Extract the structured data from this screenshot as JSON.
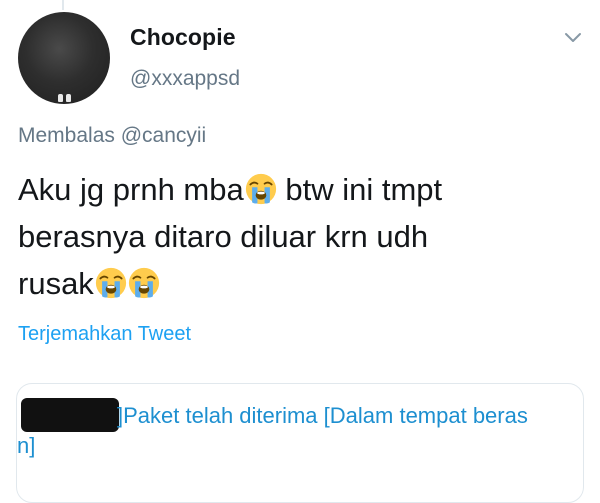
{
  "tweet": {
    "author": {
      "display_name": "Chocopie",
      "handle": "@xxxappsd"
    },
    "reply_prefix": "Membalas",
    "reply_to": "@cancyii",
    "text_lines": [
      "Aku jg prnh mba",
      " btw ini tmpt",
      "berasnya ditaro diluar krn udh",
      "rusak"
    ],
    "emoji": "loudly-crying-face",
    "translate_label": "Terjemahkan Tweet",
    "quote": {
      "line1": "]Paket telah diterima [Dalam tempat beras",
      "line2": "n]"
    }
  },
  "icons": {
    "menu": "chevron-down-icon"
  },
  "colors": {
    "link": "#1da1f2",
    "secondary": "#657786",
    "text": "#14171a"
  }
}
